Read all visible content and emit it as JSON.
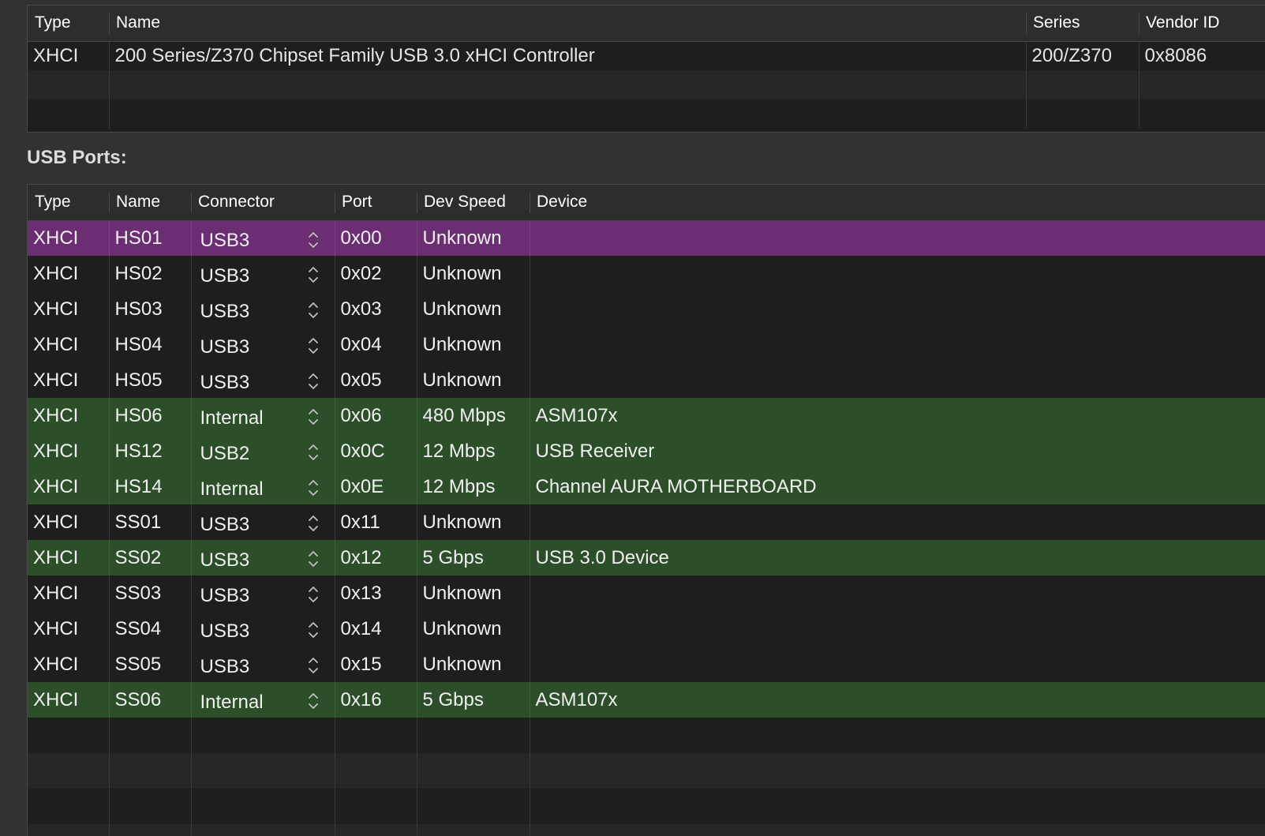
{
  "controllers": {
    "columns": [
      "Type",
      "Name",
      "Series",
      "Vendor ID"
    ],
    "rows": [
      {
        "type": "XHCI",
        "name": "200 Series/Z370 Chipset Family USB 3.0 xHCI Controller",
        "series": "200/Z370",
        "vendor_id": "0x8086"
      }
    ]
  },
  "usb_ports": {
    "label": "USB Ports:",
    "columns": [
      "Type",
      "Name",
      "Connector",
      "Port",
      "Dev Speed",
      "Device"
    ],
    "rows": [
      {
        "type": "XHCI",
        "name": "HS01",
        "connector": "USB3",
        "port": "0x00",
        "speed": "Unknown",
        "device": "",
        "state": "selected"
      },
      {
        "type": "XHCI",
        "name": "HS02",
        "connector": "USB3",
        "port": "0x02",
        "speed": "Unknown",
        "device": "",
        "state": "normal"
      },
      {
        "type": "XHCI",
        "name": "HS03",
        "connector": "USB3",
        "port": "0x03",
        "speed": "Unknown",
        "device": "",
        "state": "normal"
      },
      {
        "type": "XHCI",
        "name": "HS04",
        "connector": "USB3",
        "port": "0x04",
        "speed": "Unknown",
        "device": "",
        "state": "normal"
      },
      {
        "type": "XHCI",
        "name": "HS05",
        "connector": "USB3",
        "port": "0x05",
        "speed": "Unknown",
        "device": "",
        "state": "normal"
      },
      {
        "type": "XHCI",
        "name": "HS06",
        "connector": "Internal",
        "port": "0x06",
        "speed": "480 Mbps",
        "device": "ASM107x",
        "state": "connected"
      },
      {
        "type": "XHCI",
        "name": "HS12",
        "connector": "USB2",
        "port": "0x0C",
        "speed": "12 Mbps",
        "device": "USB Receiver",
        "state": "connected"
      },
      {
        "type": "XHCI",
        "name": "HS14",
        "connector": "Internal",
        "port": "0x0E",
        "speed": "12 Mbps",
        "device": "Channel AURA MOTHERBOARD",
        "state": "connected"
      },
      {
        "type": "XHCI",
        "name": "SS01",
        "connector": "USB3",
        "port": "0x11",
        "speed": "Unknown",
        "device": "",
        "state": "normal"
      },
      {
        "type": "XHCI",
        "name": "SS02",
        "connector": "USB3",
        "port": "0x12",
        "speed": "5 Gbps",
        "device": "USB 3.0 Device",
        "state": "connected"
      },
      {
        "type": "XHCI",
        "name": "SS03",
        "connector": "USB3",
        "port": "0x13",
        "speed": "Unknown",
        "device": "",
        "state": "normal"
      },
      {
        "type": "XHCI",
        "name": "SS04",
        "connector": "USB3",
        "port": "0x14",
        "speed": "Unknown",
        "device": "",
        "state": "normal"
      },
      {
        "type": "XHCI",
        "name": "SS05",
        "connector": "USB3",
        "port": "0x15",
        "speed": "Unknown",
        "device": "",
        "state": "normal"
      },
      {
        "type": "XHCI",
        "name": "SS06",
        "connector": "Internal",
        "port": "0x16",
        "speed": "5 Gbps",
        "device": "ASM107x",
        "state": "connected"
      }
    ]
  },
  "colors": {
    "selected_row": "#6b2e72",
    "connected_row": "#2c4f29",
    "background": "#1e1e1e"
  }
}
